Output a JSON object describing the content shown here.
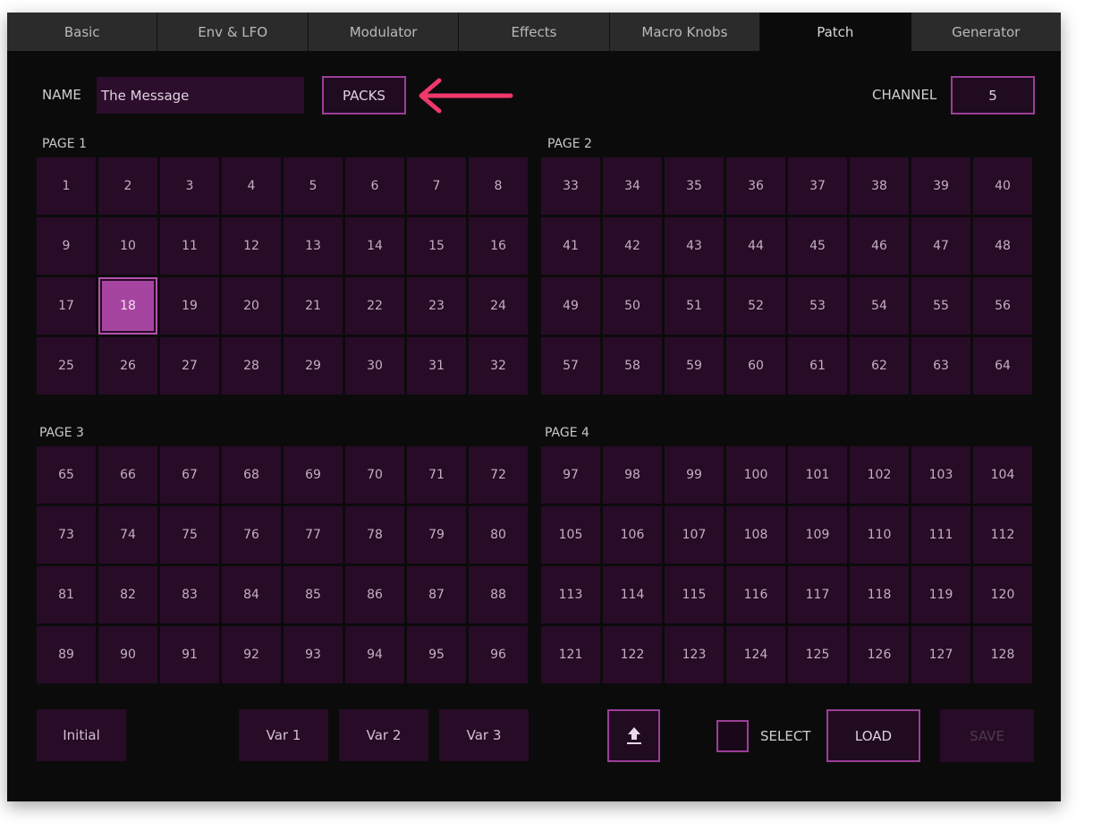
{
  "tabs": [
    "Basic",
    "Env & LFO",
    "Modulator",
    "Effects",
    "Macro Knobs",
    "Patch",
    "Generator"
  ],
  "active_tab_index": 5,
  "name": {
    "label": "NAME",
    "value": "The Message"
  },
  "packs_label": "PACKS",
  "channel": {
    "label": "CHANNEL",
    "value": "5"
  },
  "pages": [
    {
      "label": "PAGE 1",
      "cells": [
        "1",
        "2",
        "3",
        "4",
        "5",
        "6",
        "7",
        "8",
        "9",
        "10",
        "11",
        "12",
        "13",
        "14",
        "15",
        "16",
        "17",
        "18",
        "19",
        "20",
        "21",
        "22",
        "23",
        "24",
        "25",
        "26",
        "27",
        "28",
        "29",
        "30",
        "31",
        "32"
      ]
    },
    {
      "label": "PAGE 2",
      "cells": [
        "33",
        "34",
        "35",
        "36",
        "37",
        "38",
        "39",
        "40",
        "41",
        "42",
        "43",
        "44",
        "45",
        "46",
        "47",
        "48",
        "49",
        "50",
        "51",
        "52",
        "53",
        "54",
        "55",
        "56",
        "57",
        "58",
        "59",
        "60",
        "61",
        "62",
        "63",
        "64"
      ]
    },
    {
      "label": "PAGE 3",
      "cells": [
        "65",
        "66",
        "67",
        "68",
        "69",
        "70",
        "71",
        "72",
        "73",
        "74",
        "75",
        "76",
        "77",
        "78",
        "79",
        "80",
        "81",
        "82",
        "83",
        "84",
        "85",
        "86",
        "87",
        "88",
        "89",
        "90",
        "91",
        "92",
        "93",
        "94",
        "95",
        "96"
      ]
    },
    {
      "label": "PAGE 4",
      "cells": [
        "97",
        "98",
        "99",
        "100",
        "101",
        "102",
        "103",
        "104",
        "105",
        "106",
        "107",
        "108",
        "109",
        "110",
        "111",
        "112",
        "113",
        "114",
        "115",
        "116",
        "117",
        "118",
        "119",
        "120",
        "121",
        "122",
        "123",
        "124",
        "125",
        "126",
        "127",
        "128"
      ]
    }
  ],
  "selected_patch": "18",
  "bottom": {
    "initial_label": "Initial",
    "var1_label": "Var 1",
    "var2_label": "Var 2",
    "var3_label": "Var 3",
    "upload_icon": "upload-icon",
    "select_label": "SELECT",
    "load_label": "LOAD",
    "save_label": "SAVE"
  },
  "colors": {
    "accent": "#a645a0",
    "cell_bg": "#280b27",
    "arrow": "#f0386b"
  }
}
